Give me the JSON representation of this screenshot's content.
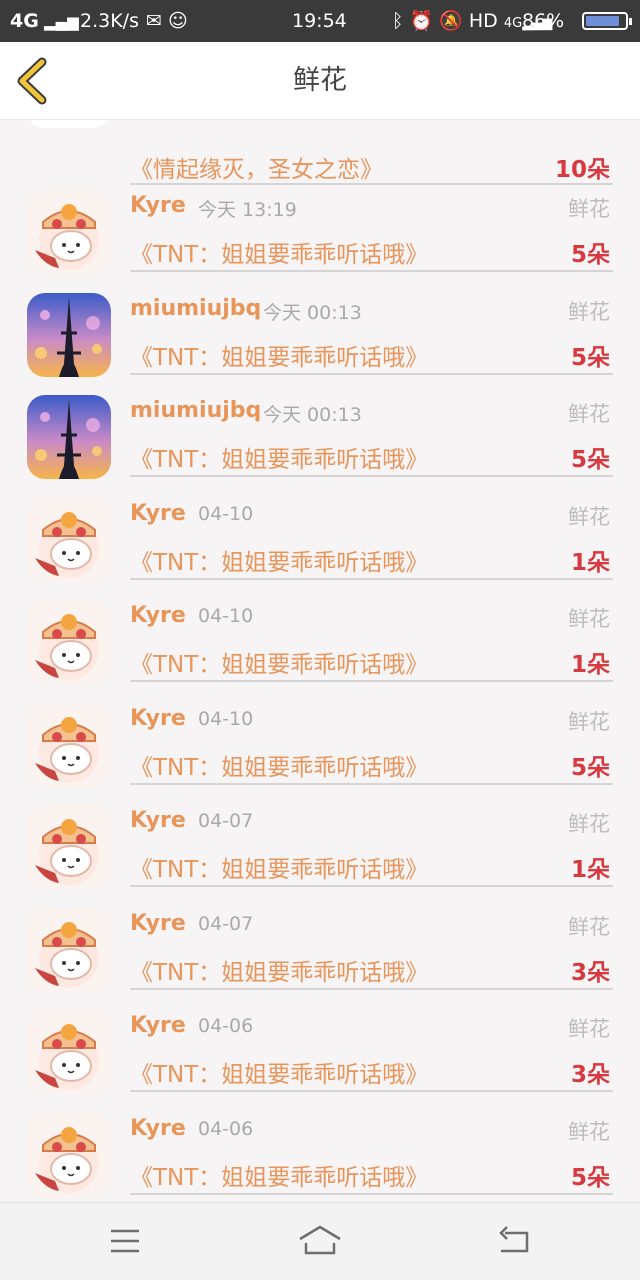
{
  "status_bar": {
    "network": "4G",
    "speed": "2.3K/s",
    "time": "19:54",
    "hd": "HD",
    "battery": "86%",
    "battery_level": 0.86
  },
  "header": {
    "title": "鲜花",
    "back_icon": "chevron-left-icon"
  },
  "list": {
    "first_row": {
      "book": "《情起缘灭，圣女之恋》",
      "count": "10朵"
    },
    "rows": [
      {
        "avatar": "kyre",
        "name": "Kyre",
        "time": "今天 13:19",
        "type": "鲜花",
        "book": "《TNT：姐姐要乖乖听话哦》",
        "count": "5朵"
      },
      {
        "avatar": "miumiu",
        "name": "miumiujbq",
        "time": "今天 00:13",
        "type": "鲜花",
        "book": "《TNT：姐姐要乖乖听话哦》",
        "count": "5朵"
      },
      {
        "avatar": "miumiu",
        "name": "miumiujbq",
        "time": "今天 00:13",
        "type": "鲜花",
        "book": "《TNT：姐姐要乖乖听话哦》",
        "count": "5朵"
      },
      {
        "avatar": "kyre",
        "name": "Kyre",
        "time": "04-10",
        "type": "鲜花",
        "book": "《TNT：姐姐要乖乖听话哦》",
        "count": "1朵"
      },
      {
        "avatar": "kyre",
        "name": "Kyre",
        "time": "04-10",
        "type": "鲜花",
        "book": "《TNT：姐姐要乖乖听话哦》",
        "count": "1朵"
      },
      {
        "avatar": "kyre",
        "name": "Kyre",
        "time": "04-10",
        "type": "鲜花",
        "book": "《TNT：姐姐要乖乖听话哦》",
        "count": "5朵"
      },
      {
        "avatar": "kyre",
        "name": "Kyre",
        "time": "04-07",
        "type": "鲜花",
        "book": "《TNT：姐姐要乖乖听话哦》",
        "count": "1朵"
      },
      {
        "avatar": "kyre",
        "name": "Kyre",
        "time": "04-07",
        "type": "鲜花",
        "book": "《TNT：姐姐要乖乖听话哦》",
        "count": "3朵"
      },
      {
        "avatar": "kyre",
        "name": "Kyre",
        "time": "04-06",
        "type": "鲜花",
        "book": "《TNT：姐姐要乖乖听话哦》",
        "count": "3朵"
      },
      {
        "avatar": "kyre",
        "name": "Kyre",
        "time": "04-06",
        "type": "鲜花",
        "book": "《TNT：姐姐要乖乖听话哦》",
        "count": "5朵"
      }
    ]
  },
  "nav_bar": {
    "menu_icon": "menu-icon",
    "home_icon": "home-icon",
    "back_icon": "return-icon"
  },
  "colors": {
    "accent": "#e8955a",
    "count": "#d6393f",
    "muted": "#bdbdbd"
  }
}
